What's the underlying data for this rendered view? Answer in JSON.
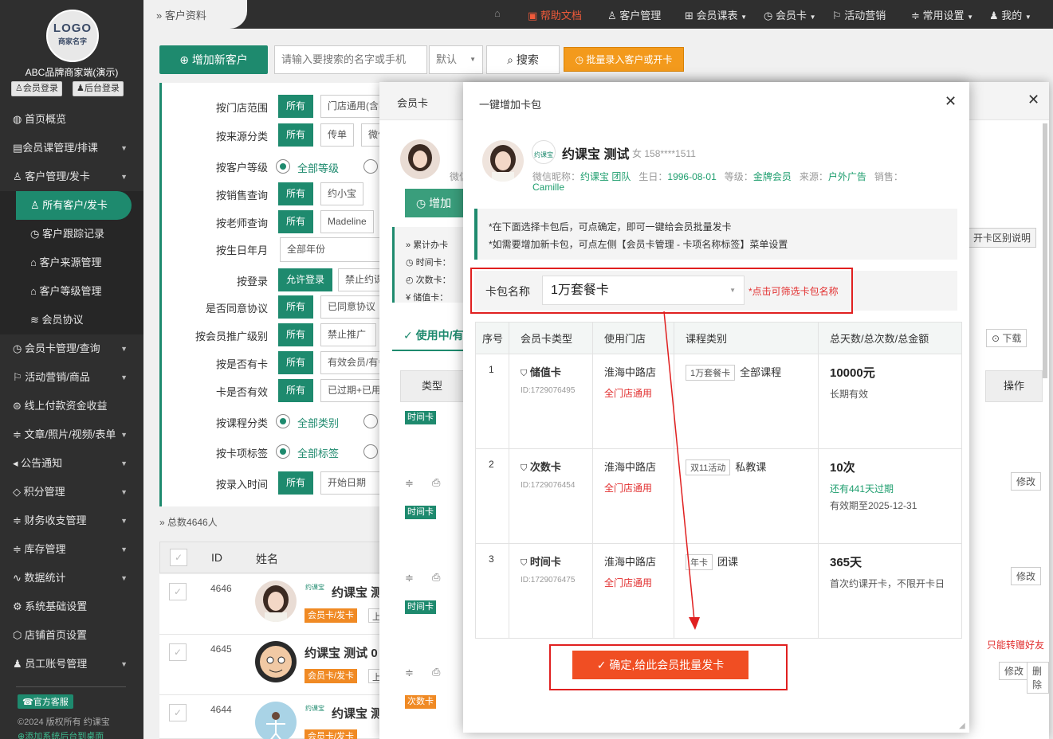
{
  "sidebar": {
    "logo_main": "LOGO",
    "logo_sub": "商家名字",
    "brand": "ABC品牌商家端(演示)",
    "member_login": "会员登录",
    "admin_login": "后台登录",
    "items": [
      {
        "label": "首页概览",
        "icon": "globe-icon"
      },
      {
        "label": "会员课管理/排课",
        "icon": "doc-icon"
      },
      {
        "label": "客户管理/发卡",
        "icon": "user-icon"
      },
      {
        "label": "所有客户/发卡",
        "icon": "user-icon"
      },
      {
        "label": "客户跟踪记录",
        "icon": "clock-icon"
      },
      {
        "label": "客户来源管理",
        "icon": "tag-icon"
      },
      {
        "label": "客户等级管理",
        "icon": "tag-icon"
      },
      {
        "label": "会员协议",
        "icon": "layers-icon"
      },
      {
        "label": "会员卡管理/查询",
        "icon": "clock-icon"
      },
      {
        "label": "活动营销/商品",
        "icon": "flag-icon"
      },
      {
        "label": "线上付款资金收益",
        "icon": "yen-icon"
      },
      {
        "label": "文章/照片/视频/表单",
        "icon": "sliders-icon"
      },
      {
        "label": "公告通知",
        "icon": "speaker-icon"
      },
      {
        "label": "积分管理",
        "icon": "diamond-icon"
      },
      {
        "label": "财务收支管理",
        "icon": "sliders-icon"
      },
      {
        "label": "库存管理",
        "icon": "sliders-icon"
      },
      {
        "label": "数据统计",
        "icon": "pulse-icon"
      },
      {
        "label": "系统基础设置",
        "icon": "gear-icon"
      },
      {
        "label": "店铺首页设置",
        "icon": "cube-icon"
      },
      {
        "label": "员工账号管理",
        "icon": "user-icon"
      }
    ],
    "service": "官方客服",
    "copyright": "©2024 版权所有 约课宝",
    "add_desktop": "添加系统后台到桌面"
  },
  "topnav": {
    "breadcrumb": "客户资料",
    "help": "帮助文档",
    "customer_mgmt": "客户管理",
    "member_course": "会员课表",
    "member_card": "会员卡",
    "marketing": "活动营销",
    "common_settings": "常用设置",
    "mine": "我的"
  },
  "toolbar": {
    "add_customer": "增加新客户",
    "search_placeholder": "请输入要搜索的名字或手机",
    "sort_default": "默认",
    "search": "搜索",
    "batch": "批量录入客户或开卡"
  },
  "filters": [
    {
      "label": "按门店范围",
      "all": "所有",
      "opt": "门店通用(含不"
    },
    {
      "label": "按来源分类",
      "all": "所有",
      "opt": "传单",
      "opt2": "微信"
    },
    {
      "label": "按客户等级",
      "radio": "全部等级"
    },
    {
      "label": "按销售查询",
      "all": "所有",
      "opt": "约小宝"
    },
    {
      "label": "按老师查询",
      "all": "所有",
      "opt": "Madeline"
    },
    {
      "label": "按生日年月",
      "select": "全部年份"
    },
    {
      "label": "按登录",
      "all": "允许登录",
      "opt": "禁止约课"
    },
    {
      "label": "是否同意协议",
      "all": "所有",
      "opt": "已同意协议"
    },
    {
      "label": "按会员推广级别",
      "all": "所有",
      "opt": "禁止推广"
    },
    {
      "label": "按是否有卡",
      "all": "所有",
      "opt": "有效会员/有会"
    },
    {
      "label": "卡是否有效",
      "all": "所有",
      "opt": "已过期+已用完"
    },
    {
      "label": "按课程分类",
      "radio": "全部类别"
    },
    {
      "label": "按卡项标签",
      "radio": "全部标签"
    },
    {
      "label": "按录入时间",
      "all": "所有",
      "opt": "开始日期"
    }
  ],
  "list": {
    "total": "总数4646人",
    "col_id": "ID",
    "col_name": "姓名",
    "rows": [
      {
        "id": "4646",
        "name": "约课宝 测",
        "tag": "会员卡/发卡",
        "tag2": "上"
      },
      {
        "id": "4645",
        "name": "约课宝 测试 0",
        "tag": "会员卡/发卡",
        "tag2": "上"
      },
      {
        "id": "4644",
        "name": "约课宝 测",
        "tag": "会员卡/发卡",
        "tag2": "上"
      }
    ]
  },
  "member_modal": {
    "title": "会员卡",
    "add_btn": "增加",
    "summary": [
      "累计办卡",
      "时间卡：",
      "次数卡：",
      "储值卡："
    ],
    "weixin_short": "微信",
    "tab_in_use": "使用中/有",
    "col_type": "类型",
    "col_action": "操作",
    "explain_btn": "开卡区别说明",
    "download": "下载",
    "types": [
      "时间卡",
      "时间卡",
      "时间卡",
      "次数卡"
    ],
    "edit": "修改",
    "delete": "删除",
    "transfer_note": "只能转赠好友"
  },
  "batch_modal": {
    "title": "一键增加卡包",
    "name": "约课宝 测试",
    "gender": "女",
    "phone": "158****1511",
    "badge": "约课宝",
    "wechat_label": "微信昵称：",
    "wechat": "约课宝 团队",
    "birthday_label": "生日：",
    "birthday": "1996-08-01",
    "level_label": "等级：",
    "level": "金牌会员",
    "source_label": "来源：",
    "source": "户外广告",
    "sales_label": "销售：",
    "sales": "Camille",
    "notice1": "*在下面选择卡包后，可点确定，即可一键给会员批量发卡",
    "notice2": "*如需要增加新卡包，可点左侧【会员卡管理 - 卡项名称标签】菜单设置",
    "package_label": "卡包名称",
    "package_value": "1万套餐卡",
    "package_hint": "*点击可筛选卡包名称",
    "headers": [
      "序号",
      "会员卡类型",
      "使用门店",
      "课程类别",
      "总天数/总次数/总金额"
    ],
    "rows": [
      {
        "no": "1",
        "type": "储值卡",
        "id": "ID:1729076495",
        "store": "淮海中路店",
        "scope": "全门店通用",
        "tag": "1万套餐卡",
        "course": "全部课程",
        "total": "10000元",
        "l1": "长期有效",
        "l2": ""
      },
      {
        "no": "2",
        "type": "次数卡",
        "id": "ID:1729076454",
        "store": "淮海中路店",
        "scope": "全门店通用",
        "tag": "双11活动",
        "course": "私教课",
        "total": "10次",
        "l1": "还有441天过期",
        "l2": "有效期至2025-12-31"
      },
      {
        "no": "3",
        "type": "时间卡",
        "id": "ID:1729076475",
        "store": "淮海中路店",
        "scope": "全门店通用",
        "tag": "年卡",
        "course": "团课",
        "total": "365天",
        "l1": "首次约课开卡，不限开卡日",
        "l2": ""
      }
    ],
    "confirm": "确定,给此会员批量发卡"
  },
  "colors": {
    "primary": "#1e8a6e",
    "sidebar": "#2f2f2f",
    "orange": "#f39a1c",
    "red": "#e02020",
    "confirm": "#f04e23"
  }
}
